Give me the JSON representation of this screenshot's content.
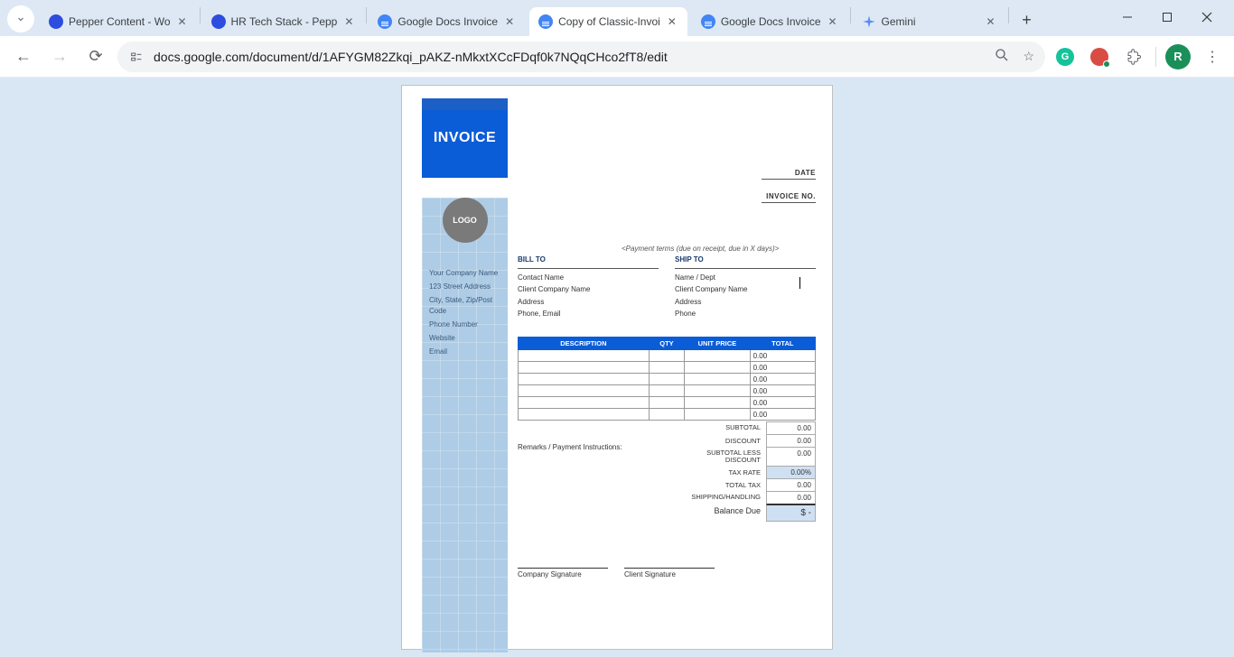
{
  "browser": {
    "tabs": [
      {
        "title": "Pepper Content - Wo"
      },
      {
        "title": "HR Tech Stack - Pepp"
      },
      {
        "title": "Google Docs Invoice"
      },
      {
        "title": "Copy of Classic-Invoi"
      },
      {
        "title": "Google Docs Invoice"
      },
      {
        "title": "Gemini"
      }
    ],
    "url": "docs.google.com/document/d/1AFYGM82Zkqi_pAKZ-nMkxtXCcFDqf0k7NQqCHco2fT8/edit",
    "profile_initial": "R"
  },
  "doc": {
    "invoice_label": "INVOICE",
    "logo_label": "LOGO",
    "sidebar": {
      "company": "Your Company Name",
      "addr1": "123 Street Address",
      "addr2": "City, State, Zip/Post Code",
      "phone": "Phone Number",
      "website": "Website",
      "email": "Email"
    },
    "top_right": {
      "date": "DATE",
      "invoice_no": "INVOICE NO."
    },
    "payment_terms": "<Payment terms (due on receipt, due in X days)>",
    "bill_to": {
      "header": "BILL TO",
      "r1": "Contact Name",
      "r2": "Client Company Name",
      "r3": "Address",
      "r4": "Phone, Email"
    },
    "ship_to": {
      "header": "SHIP TO",
      "r1": "Name / Dept",
      "r2": "Client Company Name",
      "r3": "Address",
      "r4": "Phone"
    },
    "table": {
      "h1": "DESCRIPTION",
      "h2": "QTY",
      "h3": "UNIT PRICE",
      "h4": "TOTAL",
      "zero": "0.00"
    },
    "remarks_label": "Remarks / Payment Instructions:",
    "summary": {
      "subtotal": "SUBTOTAL",
      "discount": "DISCOUNT",
      "sub_less": "SUBTOTAL LESS DISCOUNT",
      "tax_rate": "TAX RATE",
      "total_tax": "TOTAL TAX",
      "shipping": "SHIPPING/HANDLING",
      "balance": "Balance Due",
      "v_sub": "0.00",
      "v_disc": "0.00",
      "v_subless": "0.00",
      "v_taxrate": "0.00%",
      "v_totaltax": "0.00",
      "v_ship": "0.00",
      "v_due": "$ -"
    },
    "sig": {
      "company": "Company Signature",
      "client": "Client Signature"
    }
  }
}
